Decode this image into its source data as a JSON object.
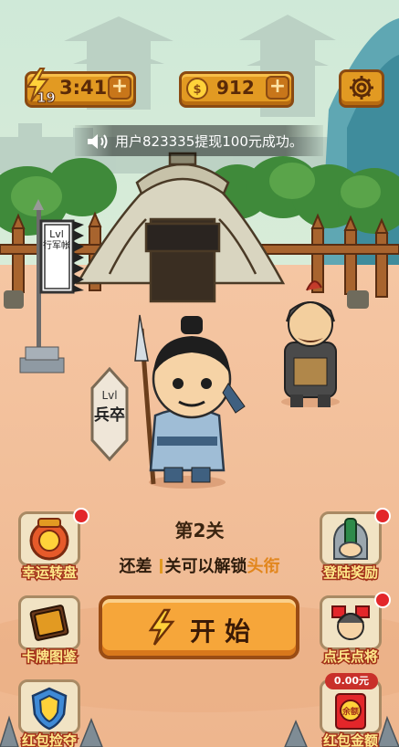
{
  "hud": {
    "energy_count": "19",
    "timer": "3:41",
    "coins": "912",
    "plus_label": "+"
  },
  "notice": {
    "text": "用户823335提现100元成功。"
  },
  "scene": {
    "tent_sign_lvl": "Lvl",
    "tent_sign_name": "行军帐",
    "rank_lvl": "Lvl",
    "rank_name": "兵卒"
  },
  "level": {
    "title": "第2关",
    "unlock_prefix": "还差",
    "unlock_middle": "关可以解锁",
    "unlock_highlight": "头衔"
  },
  "start_button": {
    "label": "开始"
  },
  "left_buttons": [
    {
      "label": "幸运转盘",
      "has_dot": true
    },
    {
      "label": "卡牌图鉴",
      "has_dot": false
    },
    {
      "label": "红包捡夺",
      "has_dot": false
    }
  ],
  "right_buttons": [
    {
      "label": "登陆奖励",
      "has_dot": true
    },
    {
      "label": "点兵点将",
      "has_dot": true
    },
    {
      "label": "红包金额",
      "has_dot": false,
      "amount": "0.00元",
      "envelope_text": "余额"
    }
  ],
  "colors": {
    "accent": "#e29a22",
    "button_border": "#8a4a12",
    "label_fill": "#ffe98a",
    "label_stroke": "#a3321a",
    "notification_dot": "#e3262a",
    "ground": "#f1b990",
    "sky": "#cfe9d6"
  },
  "icons": [
    "lightning-icon",
    "coin-icon",
    "gear-icon",
    "speaker-icon"
  ]
}
